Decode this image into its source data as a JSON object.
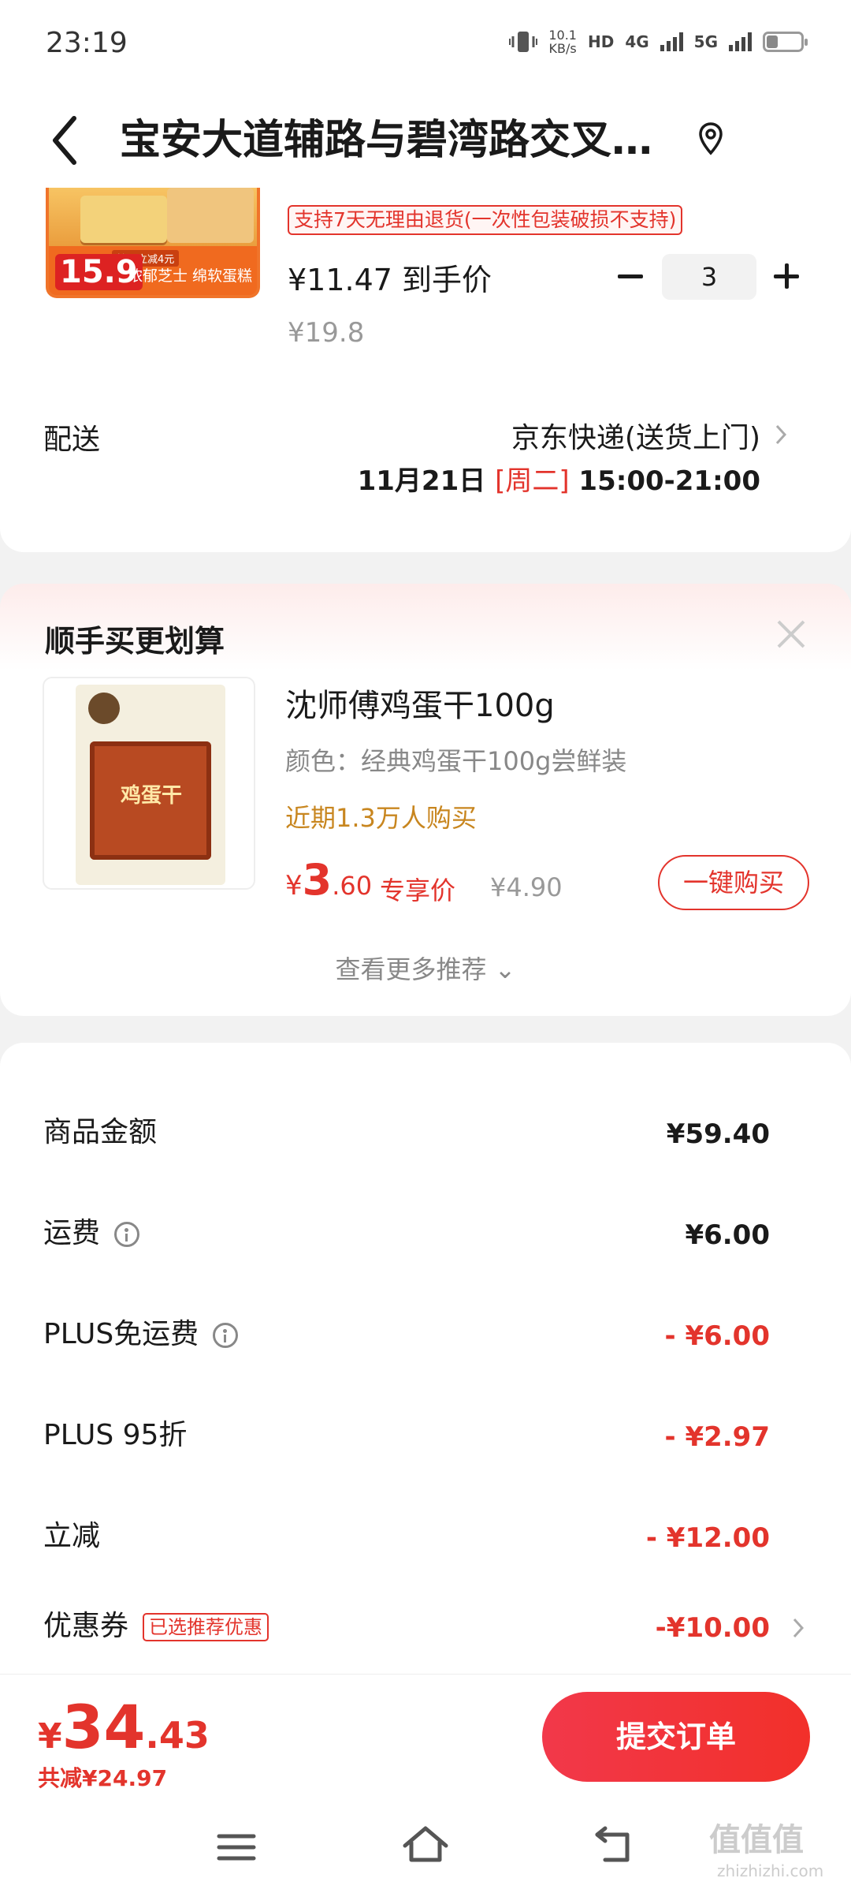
{
  "status_bar": {
    "time": "23:19",
    "net_speed_top": "10.1",
    "net_speed_unit": "KB/s",
    "hd_badge": "HD",
    "net1": "4G",
    "net2": "5G"
  },
  "header": {
    "title": "宝安大道辅路与碧湾路交叉…",
    "back_icon": "back-chevron-icon",
    "location_icon": "location-pin-icon"
  },
  "product": {
    "image_price": "15.9",
    "image_promo": "拍下立减4元",
    "image_slogan": "浓郁芝士 绵软蛋糕",
    "return_policy": "支持7天无理由退货(一次性包装破损不支持)",
    "final_price": "¥11.47 到手价",
    "original_price": "¥19.8",
    "quantity": "3"
  },
  "shipping": {
    "label": "配送",
    "method": "京东快递(送货上门)",
    "date": "11月21日 ",
    "weekday": "[周二]",
    "time_slot": " 15:00-21:00"
  },
  "recommendation": {
    "title": "顺手买更划算",
    "name": "沈师傅鸡蛋干100g",
    "spec": "颜色：经典鸡蛋干100g尝鲜装",
    "sales": "近期1.3万人购买",
    "price_currency": "¥",
    "price_int": "3",
    "price_dec": ".60",
    "price_tag": "专享价",
    "original_price": "¥4.90",
    "buy_button": "一键购买",
    "image_label": "鸡蛋干",
    "more": "查看更多推荐 ⌄"
  },
  "summary": {
    "rows": [
      {
        "label": "商品金额",
        "value": "¥59.40"
      },
      {
        "label": "运费",
        "value": "¥6.00"
      },
      {
        "label": "PLUS免运费",
        "value": "- ¥6.00"
      },
      {
        "label": "PLUS 95折",
        "value": "- ¥2.97"
      },
      {
        "label": "立减",
        "value": "- ¥12.00"
      },
      {
        "label": "优惠券",
        "value": "-¥10.00",
        "tag": "已选推荐优惠"
      }
    ]
  },
  "bottom_bar": {
    "total_currency": "¥",
    "total_int": "34",
    "total_dec": ".43",
    "saved": "共减¥24.97",
    "submit": "提交订单"
  },
  "watermark": {
    "text": "值值值",
    "sub": "zhizhizhi.com"
  },
  "colors": {
    "accent_red": "#e3342c",
    "sales_orange": "#c8861f"
  }
}
